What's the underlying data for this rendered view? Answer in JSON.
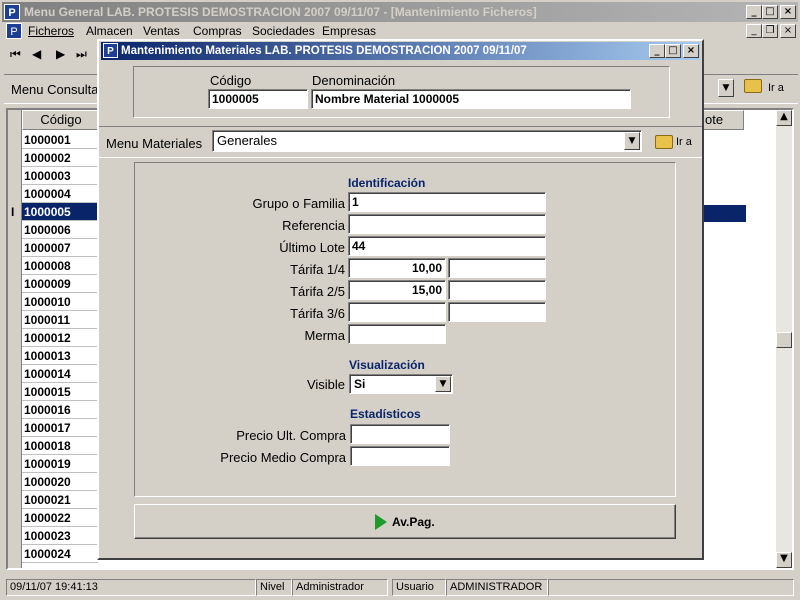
{
  "main_window": {
    "title": "Menu General   LAB. PROTESIS DEMOSTRACION   2007   09/11/07 - [Mantenimiento Ficheros]",
    "menu": [
      "Ficheros",
      "Almacen",
      "Ventas",
      "Compras",
      "Sociedades",
      "Empresas"
    ],
    "menu_consultas_label": "Menu Consultas",
    "ir_a_label": "Ir a",
    "grid_header_codigo": "Código",
    "grid_header_right": "ote",
    "row_indicator": "I",
    "rows": [
      "1000001",
      "1000002",
      "1000003",
      "1000004",
      "1000005",
      "1000006",
      "1000007",
      "1000008",
      "1000009",
      "1000010",
      "1000011",
      "1000012",
      "1000013",
      "1000014",
      "1000015",
      "1000016",
      "1000017",
      "1000018",
      "1000019",
      "1000020",
      "1000021",
      "1000022",
      "1000023",
      "1000024"
    ],
    "selected_row": "1000005"
  },
  "dialog": {
    "title": "Mantenimiento Materiales  LAB. PROTESIS DEMOSTRACION  2007  09/11/07",
    "codigo_label": "Código",
    "codigo_value": "1000005",
    "denominacion_label": "Denominación",
    "denominacion_value": "Nombre Material 1000005",
    "menu_materiales_label": "Menu Materiales",
    "menu_materiales_value": "Generales",
    "ir_a_label": "Ir a",
    "identificacion_title": "Identificación",
    "grupo_label": "Grupo o Familia",
    "grupo_value": "1",
    "referencia_label": "Referencia",
    "referencia_value": "",
    "ultimo_lote_label": "Último Lote",
    "ultimo_lote_value": "44",
    "tarifa14_label": "Tárifa 1/4",
    "tarifa14_value": "10,00",
    "tarifa14_value2": "",
    "tarifa25_label": "Tárifa 2/5",
    "tarifa25_value": "15,00",
    "tarifa25_value2": "",
    "tarifa36_label": "Tárifa 3/6",
    "tarifa36_value": "",
    "tarifa36_value2": "",
    "merma_label": "Merma",
    "merma_value": "",
    "visualizacion_title": "Visualización",
    "visible_label": "Visible",
    "visible_value": "Si",
    "estadisticos_title": "Estadísticos",
    "precio_ult_label": "Precio Ult. Compra",
    "precio_ult_value": "",
    "precio_medio_label": "Precio Medio Compra",
    "precio_medio_value": "",
    "avpag_label": "Av.Pag."
  },
  "status_bar": {
    "datetime": "09/11/07 19:41:13",
    "nivel_label": "Nivel",
    "nivel_value": "Administrador",
    "usuario_label": "Usuario",
    "usuario_value": "ADMINISTRADOR"
  }
}
